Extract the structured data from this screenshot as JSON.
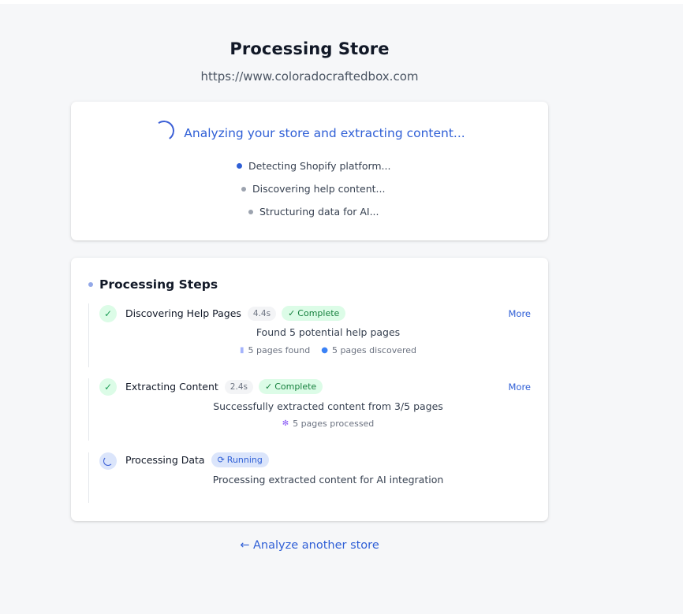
{
  "header": {
    "title": "Processing Store",
    "url": "https://www.coloradocraftedbox.com"
  },
  "status": {
    "message": "Analyzing your store and extracting content...",
    "phases": [
      {
        "label": "Detecting Shopify platform...",
        "active": true
      },
      {
        "label": "Discovering help content...",
        "active": false
      },
      {
        "label": "Structuring data for AI...",
        "active": false
      }
    ]
  },
  "steps_section": {
    "heading": "Processing Steps",
    "more_label": "More",
    "steps": [
      {
        "title": "Discovering Help Pages",
        "duration": "4.4s",
        "status_icon": "✓",
        "status": "Complete",
        "description": "Found 5 potential help pages",
        "meta": [
          {
            "icon": "page-icon",
            "text": "5 pages found"
          },
          {
            "icon": "search-icon",
            "text": "5 pages discovered"
          }
        ]
      },
      {
        "title": "Extracting Content",
        "duration": "2.4s",
        "status_icon": "✓",
        "status": "Complete",
        "description": "Successfully extracted content from 3/5 pages",
        "meta": [
          {
            "icon": "gear-icon",
            "text": "5 pages processed"
          }
        ]
      },
      {
        "title": "Processing Data",
        "status_icon": "⟳",
        "status": "Running",
        "description": "Processing extracted content for AI integration"
      }
    ]
  },
  "footer": {
    "back_link": "← Analyze another store"
  },
  "colors": {
    "accent": "#2f5fd6",
    "complete_bg": "#dcfce7",
    "complete_text": "#15803d",
    "running_bg": "#dbe5fb"
  }
}
